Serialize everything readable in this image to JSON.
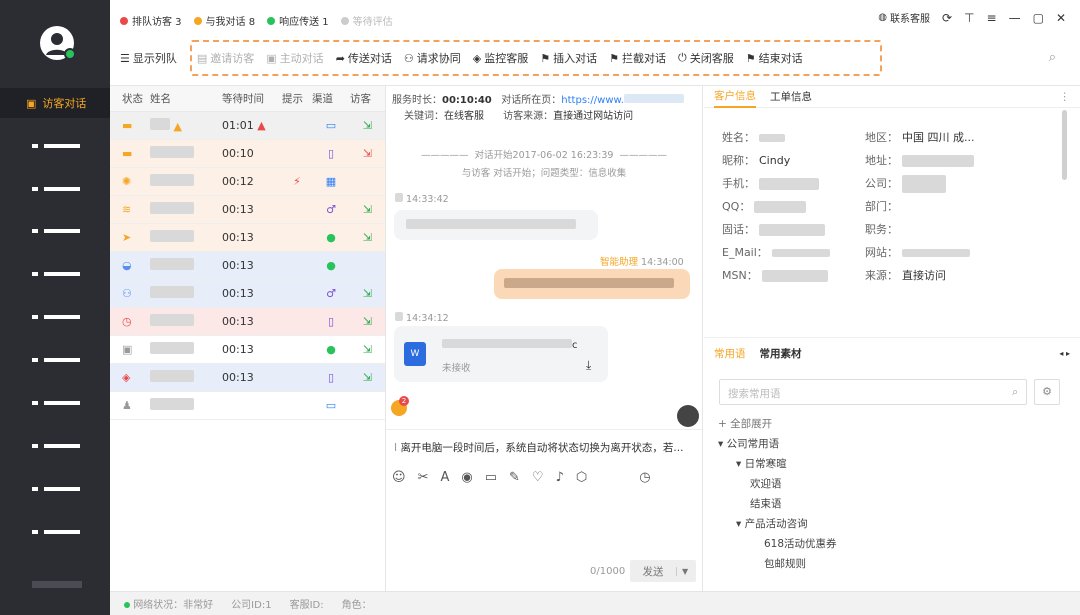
{
  "stats": {
    "queue": "排队访客 3",
    "talking": "与我对话 8",
    "responding": "响应传送 1",
    "waiting": "等待评估"
  },
  "window": {
    "support": "联系客服"
  },
  "toolbar": {
    "showQueue": "显示列队",
    "invite": "邀请访客",
    "active": "主动对话",
    "transfer": "传送对话",
    "assist": "请求协同",
    "monitor": "监控客服",
    "insert": "插入对话",
    "intercept": "拦截对话",
    "closeService": "关闭客服",
    "end": "结束对话"
  },
  "sidebar": {
    "active": "访客对话"
  },
  "list": {
    "headers": [
      "状态",
      "姓名",
      "等待时间",
      "提示",
      "渠道",
      "访客"
    ],
    "rows": [
      {
        "time": "01:01"
      },
      {
        "time": "00:10"
      },
      {
        "time": "00:12"
      },
      {
        "time": "00:13"
      },
      {
        "time": "00:13"
      },
      {
        "time": "00:13"
      },
      {
        "time": "00:13"
      },
      {
        "time": "00:13"
      },
      {
        "time": "00:13"
      },
      {
        "time": "00:13"
      },
      {
        "time": ""
      }
    ]
  },
  "chat": {
    "durationLabel": "服务时长：",
    "duration": "00:10:40",
    "pageLabel": "对话所在页：",
    "pageUrl": "https://www.",
    "keywordLabel": "关键词：",
    "keyword": "在线客服",
    "sourceLabel": "访客来源：",
    "source": "直接通过网站访问",
    "started": "对话开始2017-06-02 16:23:39",
    "startedDesc": "与访客 对话开始；问题类型：信息收集",
    "t1": "14:33:42",
    "aiLabel": "智能助理",
    "t2": "14:34:00",
    "t3": "14:34:12",
    "fileStatus": "未接收",
    "fileExt": "c",
    "inputText": "离开电脑一段时间后，系统自动将状态切换为离开状态，若...",
    "counter": "0/1000",
    "send": "发送"
  },
  "info": {
    "tabCustomer": "客户信息",
    "tabTicket": "工单信息",
    "fields": {
      "name": "姓名：",
      "region": "地区：",
      "regionVal": "中国 四川 成...",
      "nick": "昵称：",
      "nickVal": "Cindy",
      "address": "地址：",
      "phone": "手机：",
      "company": "公司：",
      "qq": "QQ：",
      "dept": "部门：",
      "tel": "固话：",
      "job": "职务：",
      "email": "E_Mail：",
      "site": "网站：",
      "msn": "MSN：",
      "from": "来源：",
      "fromVal": "直接访问"
    },
    "tabPhrases": "常用语",
    "tabMaterial": "常用素材",
    "searchPlaceholder": "搜索常用语",
    "tree": {
      "expand": "+ 全部展开",
      "root": "▾ 公司常用语",
      "g1": "▾ 日常寒暄",
      "welcome": "欢迎语",
      "bye": "结束语",
      "g2": "▾ 产品活动咨询",
      "promo": "618活动优惠券",
      "shipping": "包邮规则"
    }
  },
  "status": {
    "net": "网络状况：非常好",
    "company": "公司ID:1",
    "agent": "客服ID:",
    "role": "角色："
  },
  "colors": {
    "accent": "#f5a623",
    "green": "#28c35a",
    "red": "#e84a4a"
  }
}
